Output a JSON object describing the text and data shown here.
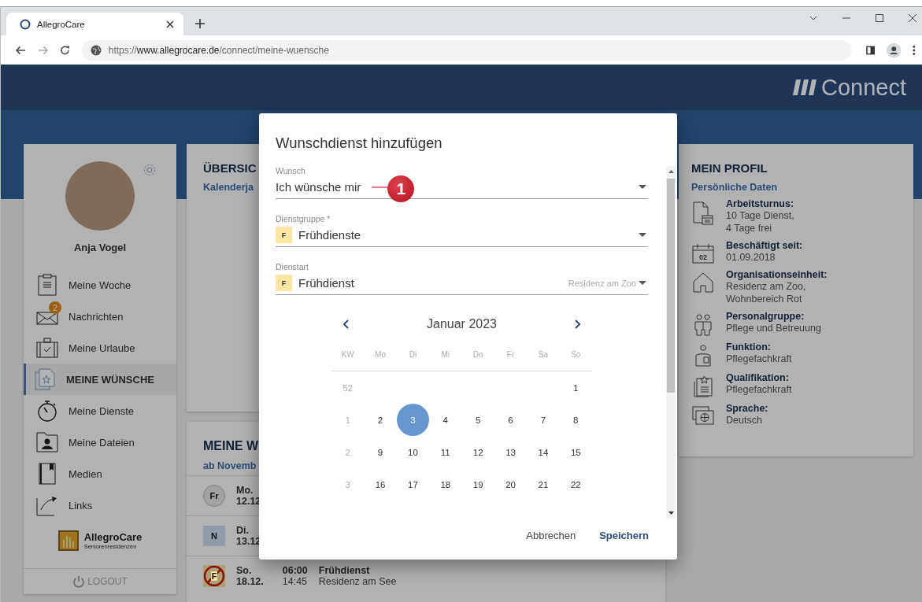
{
  "browser": {
    "tab_title": "AllegroCare",
    "url": {
      "scheme": "https://",
      "host": "www.allegrocare.de",
      "path": "/connect/meine-wuensche"
    }
  },
  "header": {
    "app_name": "Connect"
  },
  "sidebar": {
    "user_name": "Anja Vogel",
    "nav": [
      {
        "label": "Meine Woche",
        "selected": false
      },
      {
        "label": "Nachrichten",
        "selected": false,
        "badge": "2"
      },
      {
        "label": "Meine Urlaube",
        "selected": false
      },
      {
        "label": "MEINE WÜNSCHE",
        "selected": true
      },
      {
        "label": "Meine Dienste",
        "selected": false
      },
      {
        "label": "Meine Dateien",
        "selected": false
      },
      {
        "label": "Medien",
        "selected": false
      },
      {
        "label": "Links",
        "selected": false
      }
    ],
    "logo_name": "AllegroCare",
    "logo_tagline": "Seniorenresidenzen",
    "logout": "LOGOUT"
  },
  "overview": {
    "title": "ÜBERSIC",
    "subtitle": "Kalenderja"
  },
  "wishes": {
    "title": "MEINE W",
    "subtitle": "ab Novemb",
    "rows": [
      {
        "kind": "circle",
        "badge": "Fr",
        "day": "Mo.",
        "date": "12.12"
      },
      {
        "kind": "square",
        "badge": "N",
        "day": "Di.",
        "date": "13.12"
      },
      {
        "kind": "crossed",
        "badge": "F",
        "day": "So.",
        "date": "18.12.",
        "start": "06:00",
        "end": "14:45",
        "shift": "Frühdienst",
        "place": "Residenz am See"
      }
    ]
  },
  "profile": {
    "title": "MEIN PROFIL",
    "subtitle": "Persönliche Daten",
    "items": [
      {
        "label": "Arbeitsturnus:",
        "lines": [
          "10 Tage Dienst,",
          "4 Tage frei"
        ]
      },
      {
        "icon_text": "02",
        "label": "Beschäftigt seit:",
        "lines": [
          "01.09.2018"
        ]
      },
      {
        "label": "Organisationseinheit:",
        "lines": [
          "Residenz am Zoo,",
          "Wohnbereich Rot"
        ]
      },
      {
        "label": "Personalgruppe:",
        "lines": [
          "Pflege und Betreuung"
        ]
      },
      {
        "label": "Funktion:",
        "lines": [
          "Pflegefachkraft"
        ]
      },
      {
        "label": "Qualifikation:",
        "lines": [
          "Pflegefachkraft"
        ]
      },
      {
        "label": "Sprache:",
        "lines": [
          "Deutsch"
        ]
      }
    ]
  },
  "dialog": {
    "title": "Wunschdienst hinzufügen",
    "fields": [
      {
        "kind": "plain",
        "label": "Wunsch",
        "value": "Ich wünsche mir",
        "callout": "1"
      },
      {
        "kind": "badge",
        "label": "Dienstgruppe *",
        "badge": "F",
        "value": "Frühdienste"
      },
      {
        "kind": "badge",
        "label": "Dienstart",
        "badge": "F",
        "value": "Frühdienst",
        "hint": "Residenz am Zoo"
      }
    ],
    "calendar": {
      "month": "Januar 2023",
      "headers": [
        "KW",
        "Mo",
        "Di",
        "Mi",
        "Do",
        "Fr",
        "Sa",
        "So"
      ],
      "weeks": [
        {
          "kw": "52",
          "days": [
            {
              "label": "1",
              "selected": false
            }
          ]
        },
        {
          "kw": "1",
          "days": [
            {
              "label": "2",
              "selected": false
            },
            {
              "label": "3",
              "selected": true
            },
            {
              "label": "4",
              "selected": false
            },
            {
              "label": "5",
              "selected": false
            },
            {
              "label": "6",
              "selected": false
            },
            {
              "label": "7",
              "selected": false
            },
            {
              "label": "8",
              "selected": false
            }
          ]
        },
        {
          "kw": "2",
          "days": [
            {
              "label": "9",
              "selected": false
            },
            {
              "label": "10",
              "selected": false
            },
            {
              "label": "11",
              "selected": false
            },
            {
              "label": "12",
              "selected": false
            },
            {
              "label": "13",
              "selected": false
            },
            {
              "label": "14",
              "selected": false
            },
            {
              "label": "15",
              "selected": false
            }
          ]
        },
        {
          "kw": "3",
          "days": [
            {
              "label": "16",
              "selected": false
            },
            {
              "label": "17",
              "selected": false
            },
            {
              "label": "18",
              "selected": false
            },
            {
              "label": "19",
              "selected": false
            },
            {
              "label": "20",
              "selected": false
            },
            {
              "label": "21",
              "selected": false
            },
            {
              "label": "22",
              "selected": false
            }
          ]
        }
      ]
    },
    "buttons": [
      {
        "label": "Abbrechen",
        "kind": "secondary"
      },
      {
        "label": "Speichern",
        "kind": "primary"
      }
    ]
  }
}
